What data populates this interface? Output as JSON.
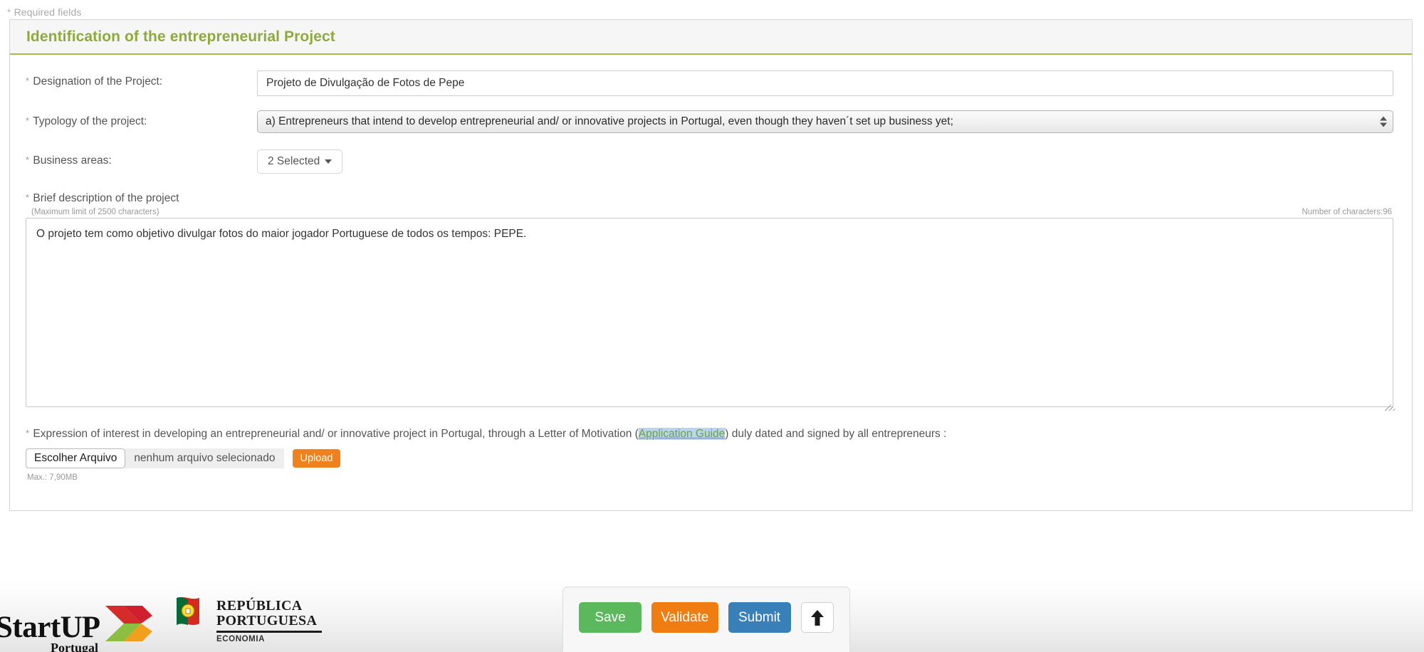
{
  "required_note": {
    "star": "*",
    "label": "Required fields"
  },
  "panel": {
    "title": "Identification of the entrepreneurial Project"
  },
  "fields": {
    "designation": {
      "star": "*",
      "label": "Designation of the Project:",
      "value": "Projeto de Divulgação de Fotos de Pepe",
      "placeholder": ""
    },
    "typology": {
      "star": "*",
      "label": "Typology of the project:",
      "selected": "a) Entrepreneurs that intend to develop entrepreneurial and/ or innovative projects in Portugal, even though they haven´t set up business yet;"
    },
    "business_areas": {
      "star": "*",
      "label": "Business areas:",
      "button_label": "2 Selected",
      "caret_icon": "caret-down-icon"
    },
    "description": {
      "star": "*",
      "label": "Brief description of the project",
      "hint": "(Maximum limit of 2500 characters)",
      "counter": "Number of characters:96",
      "value": "O projeto tem como objetivo divulgar fotos do maior jogador Portuguese de todos os tempos: PEPE.",
      "placeholder": ""
    }
  },
  "upload": {
    "star": "*",
    "text_before_link": "Expression of interest in developing an entrepreneurial and/ or innovative project in Portugal, through a Letter of Motivation (",
    "link_label": "Application Guide",
    "text_after_link": ") duly dated and signed by all entrepreneurs :",
    "choose_file_label": "Escolher Arquivo",
    "file_name": "nenhum arquivo selecionado",
    "upload_button_label": "Upload",
    "max_note": "Max.: 7,90MB"
  },
  "footer": {
    "logo_startup": {
      "part1": "Start",
      "part2": "UP",
      "subtitle": "Portugal",
      "icon": "startup-arrow-icon"
    },
    "logo_republica": {
      "shield_icon": "portugal-shield-icon",
      "line1": "REPÚBLICA",
      "line2": "PORTUGUESA",
      "department": "ECONOMIA"
    },
    "actions": {
      "save": "Save",
      "validate": "Validate",
      "submit": "Submit",
      "scroll_top_icon": "arrow-up-icon"
    }
  },
  "colors": {
    "brand_green": "#8faa3c",
    "header_border_green": "#a9b951",
    "save_green": "#5cb85c",
    "validate_orange": "#ef7d12",
    "submit_blue": "#3a80b8",
    "upload_orange": "#f0821e",
    "link_green": "#6ca33a",
    "link_highlight": "#b9d4f0"
  }
}
